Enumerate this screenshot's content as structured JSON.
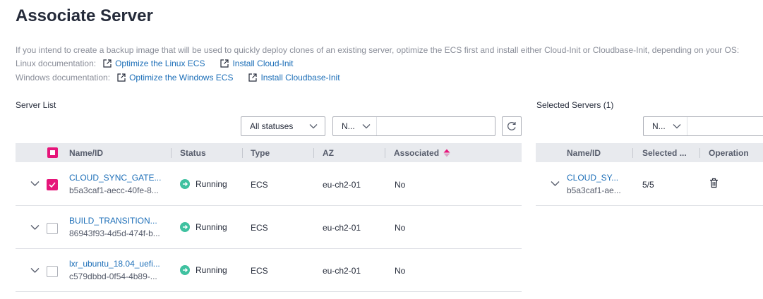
{
  "page": {
    "title": "Associate Server",
    "intro": "If you intend to create a backup image that will be used to quickly deploy clones of an existing server, optimize the ECS first and install either Cloud-Init or Cloudbase-Init, depending on your OS:"
  },
  "docs": {
    "linux_label": "Linux documentation:",
    "linux_links": [
      "Optimize the Linux ECS",
      "Install Cloud-Init"
    ],
    "windows_label": "Windows documentation:",
    "windows_links": [
      "Optimize the Windows ECS",
      "Install Cloudbase-Init"
    ]
  },
  "server_list": {
    "label": "Server List",
    "status_filter": "All statuses",
    "search_property": "N...",
    "search_placeholder": "",
    "columns": [
      "Name/ID",
      "Status",
      "Type",
      "AZ",
      "Associated"
    ],
    "rows": [
      {
        "name": "CLOUD_SYNC_GATE...",
        "id": "b5a3caf1-aecc-40fe-8...",
        "status": "Running",
        "type": "ECS",
        "az": "eu-ch2-01",
        "associated": "No",
        "checked": true
      },
      {
        "name": "BUILD_TRANSITION...",
        "id": "86943f93-4d5d-474f-b...",
        "status": "Running",
        "type": "ECS",
        "az": "eu-ch2-01",
        "associated": "No",
        "checked": false
      },
      {
        "name": "lxr_ubuntu_18.04_uefi...",
        "id": "c579dbbd-0f54-4b89-...",
        "status": "Running",
        "type": "ECS",
        "az": "eu-ch2-01",
        "associated": "No",
        "checked": false
      }
    ]
  },
  "selected": {
    "label": "Selected Servers (1)",
    "search_property": "N...",
    "columns": [
      "Name/ID",
      "Selected ...",
      "Operation"
    ],
    "rows": [
      {
        "name": "CLOUD_SY...",
        "id": "b5a3caf1-ae...",
        "selected": "5/5"
      }
    ]
  },
  "colors": {
    "accent": "#e6157a",
    "link": "#1d6fb8",
    "running": "#3fc1a0"
  }
}
